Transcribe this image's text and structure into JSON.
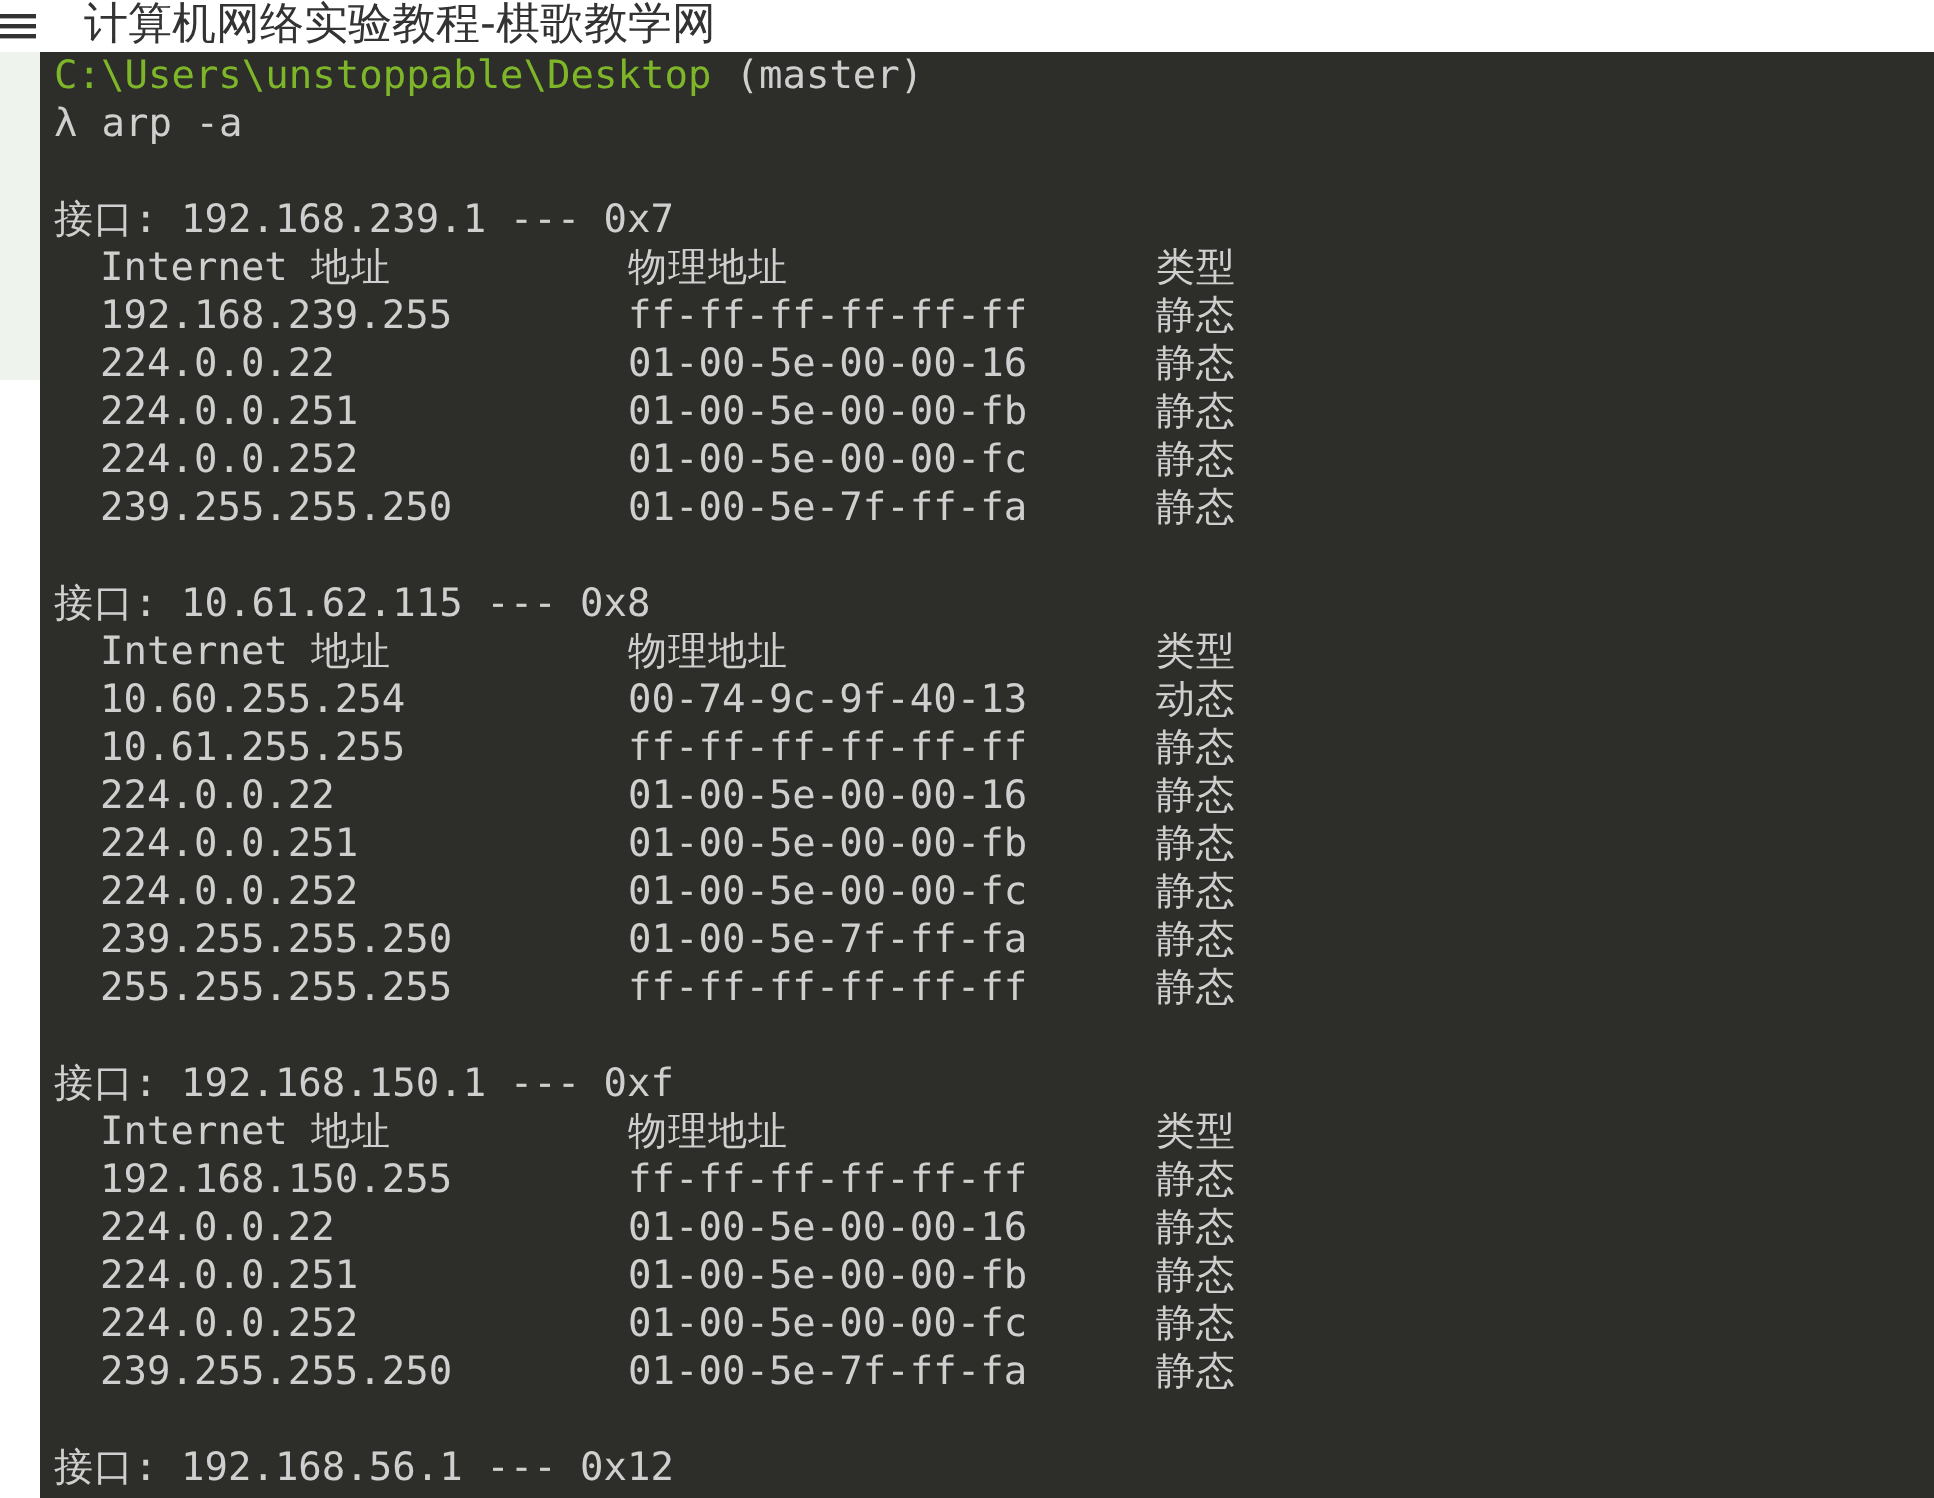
{
  "page": {
    "title": "计算机网络实验教程-棋歌教学网"
  },
  "terminal": {
    "path": "C:\\Users\\unstoppable\\Desktop",
    "branch": "(master)",
    "prompt": "λ",
    "command": "arp -a",
    "interfaces": [
      {
        "header": "接口: 192.168.239.1 --- 0x7",
        "columns": [
          "Internet 地址",
          "物理地址",
          "类型"
        ],
        "rows": [
          {
            "address": "192.168.239.255",
            "mac": "ff-ff-ff-ff-ff-ff",
            "type": "静态"
          },
          {
            "address": "224.0.0.22",
            "mac": "01-00-5e-00-00-16",
            "type": "静态"
          },
          {
            "address": "224.0.0.251",
            "mac": "01-00-5e-00-00-fb",
            "type": "静态"
          },
          {
            "address": "224.0.0.252",
            "mac": "01-00-5e-00-00-fc",
            "type": "静态"
          },
          {
            "address": "239.255.255.250",
            "mac": "01-00-5e-7f-ff-fa",
            "type": "静态"
          }
        ]
      },
      {
        "header": "接口: 10.61.62.115 --- 0x8",
        "columns": [
          "Internet 地址",
          "物理地址",
          "类型"
        ],
        "rows": [
          {
            "address": "10.60.255.254",
            "mac": "00-74-9c-9f-40-13",
            "type": "动态"
          },
          {
            "address": "10.61.255.255",
            "mac": "ff-ff-ff-ff-ff-ff",
            "type": "静态"
          },
          {
            "address": "224.0.0.22",
            "mac": "01-00-5e-00-00-16",
            "type": "静态"
          },
          {
            "address": "224.0.0.251",
            "mac": "01-00-5e-00-00-fb",
            "type": "静态"
          },
          {
            "address": "224.0.0.252",
            "mac": "01-00-5e-00-00-fc",
            "type": "静态"
          },
          {
            "address": "239.255.255.250",
            "mac": "01-00-5e-7f-ff-fa",
            "type": "静态"
          },
          {
            "address": "255.255.255.255",
            "mac": "ff-ff-ff-ff-ff-ff",
            "type": "静态"
          }
        ]
      },
      {
        "header": "接口: 192.168.150.1 --- 0xf",
        "columns": [
          "Internet 地址",
          "物理地址",
          "类型"
        ],
        "rows": [
          {
            "address": "192.168.150.255",
            "mac": "ff-ff-ff-ff-ff-ff",
            "type": "静态"
          },
          {
            "address": "224.0.0.22",
            "mac": "01-00-5e-00-00-16",
            "type": "静态"
          },
          {
            "address": "224.0.0.251",
            "mac": "01-00-5e-00-00-fb",
            "type": "静态"
          },
          {
            "address": "224.0.0.252",
            "mac": "01-00-5e-00-00-fc",
            "type": "静态"
          },
          {
            "address": "239.255.255.250",
            "mac": "01-00-5e-7f-ff-fa",
            "type": "静态"
          }
        ]
      },
      {
        "header": "接口: 192.168.56.1 --- 0x12"
      }
    ]
  }
}
